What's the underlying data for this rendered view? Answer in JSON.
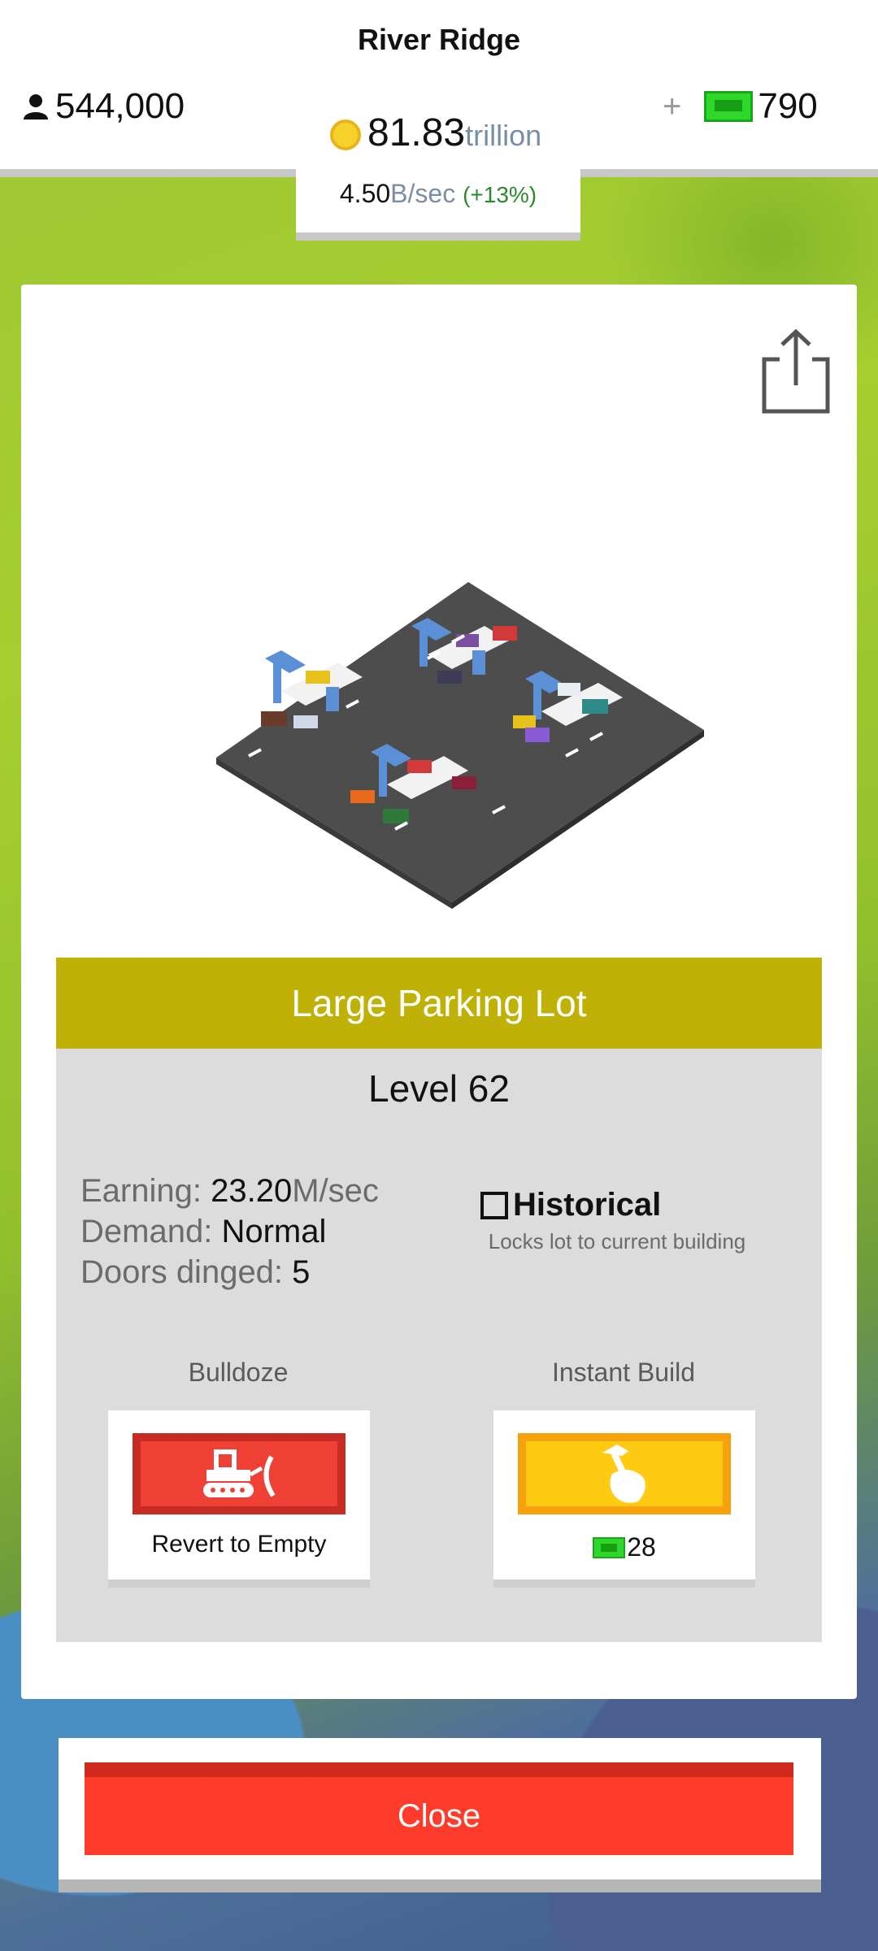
{
  "header": {
    "city_name": "River Ridge",
    "population": "544,000",
    "cash_amount": "81.83",
    "cash_unit": "trillion",
    "plus_symbol": "+",
    "bucks": "790",
    "rate_value": "4.50",
    "rate_unit": "B/sec",
    "rate_change": "(+13%)"
  },
  "building": {
    "name": "Large Parking Lot",
    "level": "Level 62",
    "earning_label": "Earning:",
    "earning_value": "23.20",
    "earning_unit": "M/sec",
    "demand_label": "Demand:",
    "demand_value": "Normal",
    "doors_label": "Doors dinged:",
    "doors_value": "5",
    "historical_label": "Historical",
    "historical_desc": "Locks lot to current building",
    "historical_checked": false
  },
  "actions": {
    "bulldoze_caption": "Bulldoze",
    "bulldoze_label": "Revert to Empty",
    "instant_caption": "Instant Build",
    "instant_cost": "28"
  },
  "footer": {
    "close_label": "Close"
  },
  "colors": {
    "title_bar": "#bfb105",
    "close_button": "#ff3b2b",
    "bulldoze_button": "#ee4035",
    "instant_button": "#ffcb12",
    "bucks_green": "#2dd82a"
  },
  "icons": [
    "person-icon",
    "coin-icon",
    "bucks-icon",
    "share-icon",
    "bulldozer-icon",
    "hammer-hand-icon"
  ]
}
